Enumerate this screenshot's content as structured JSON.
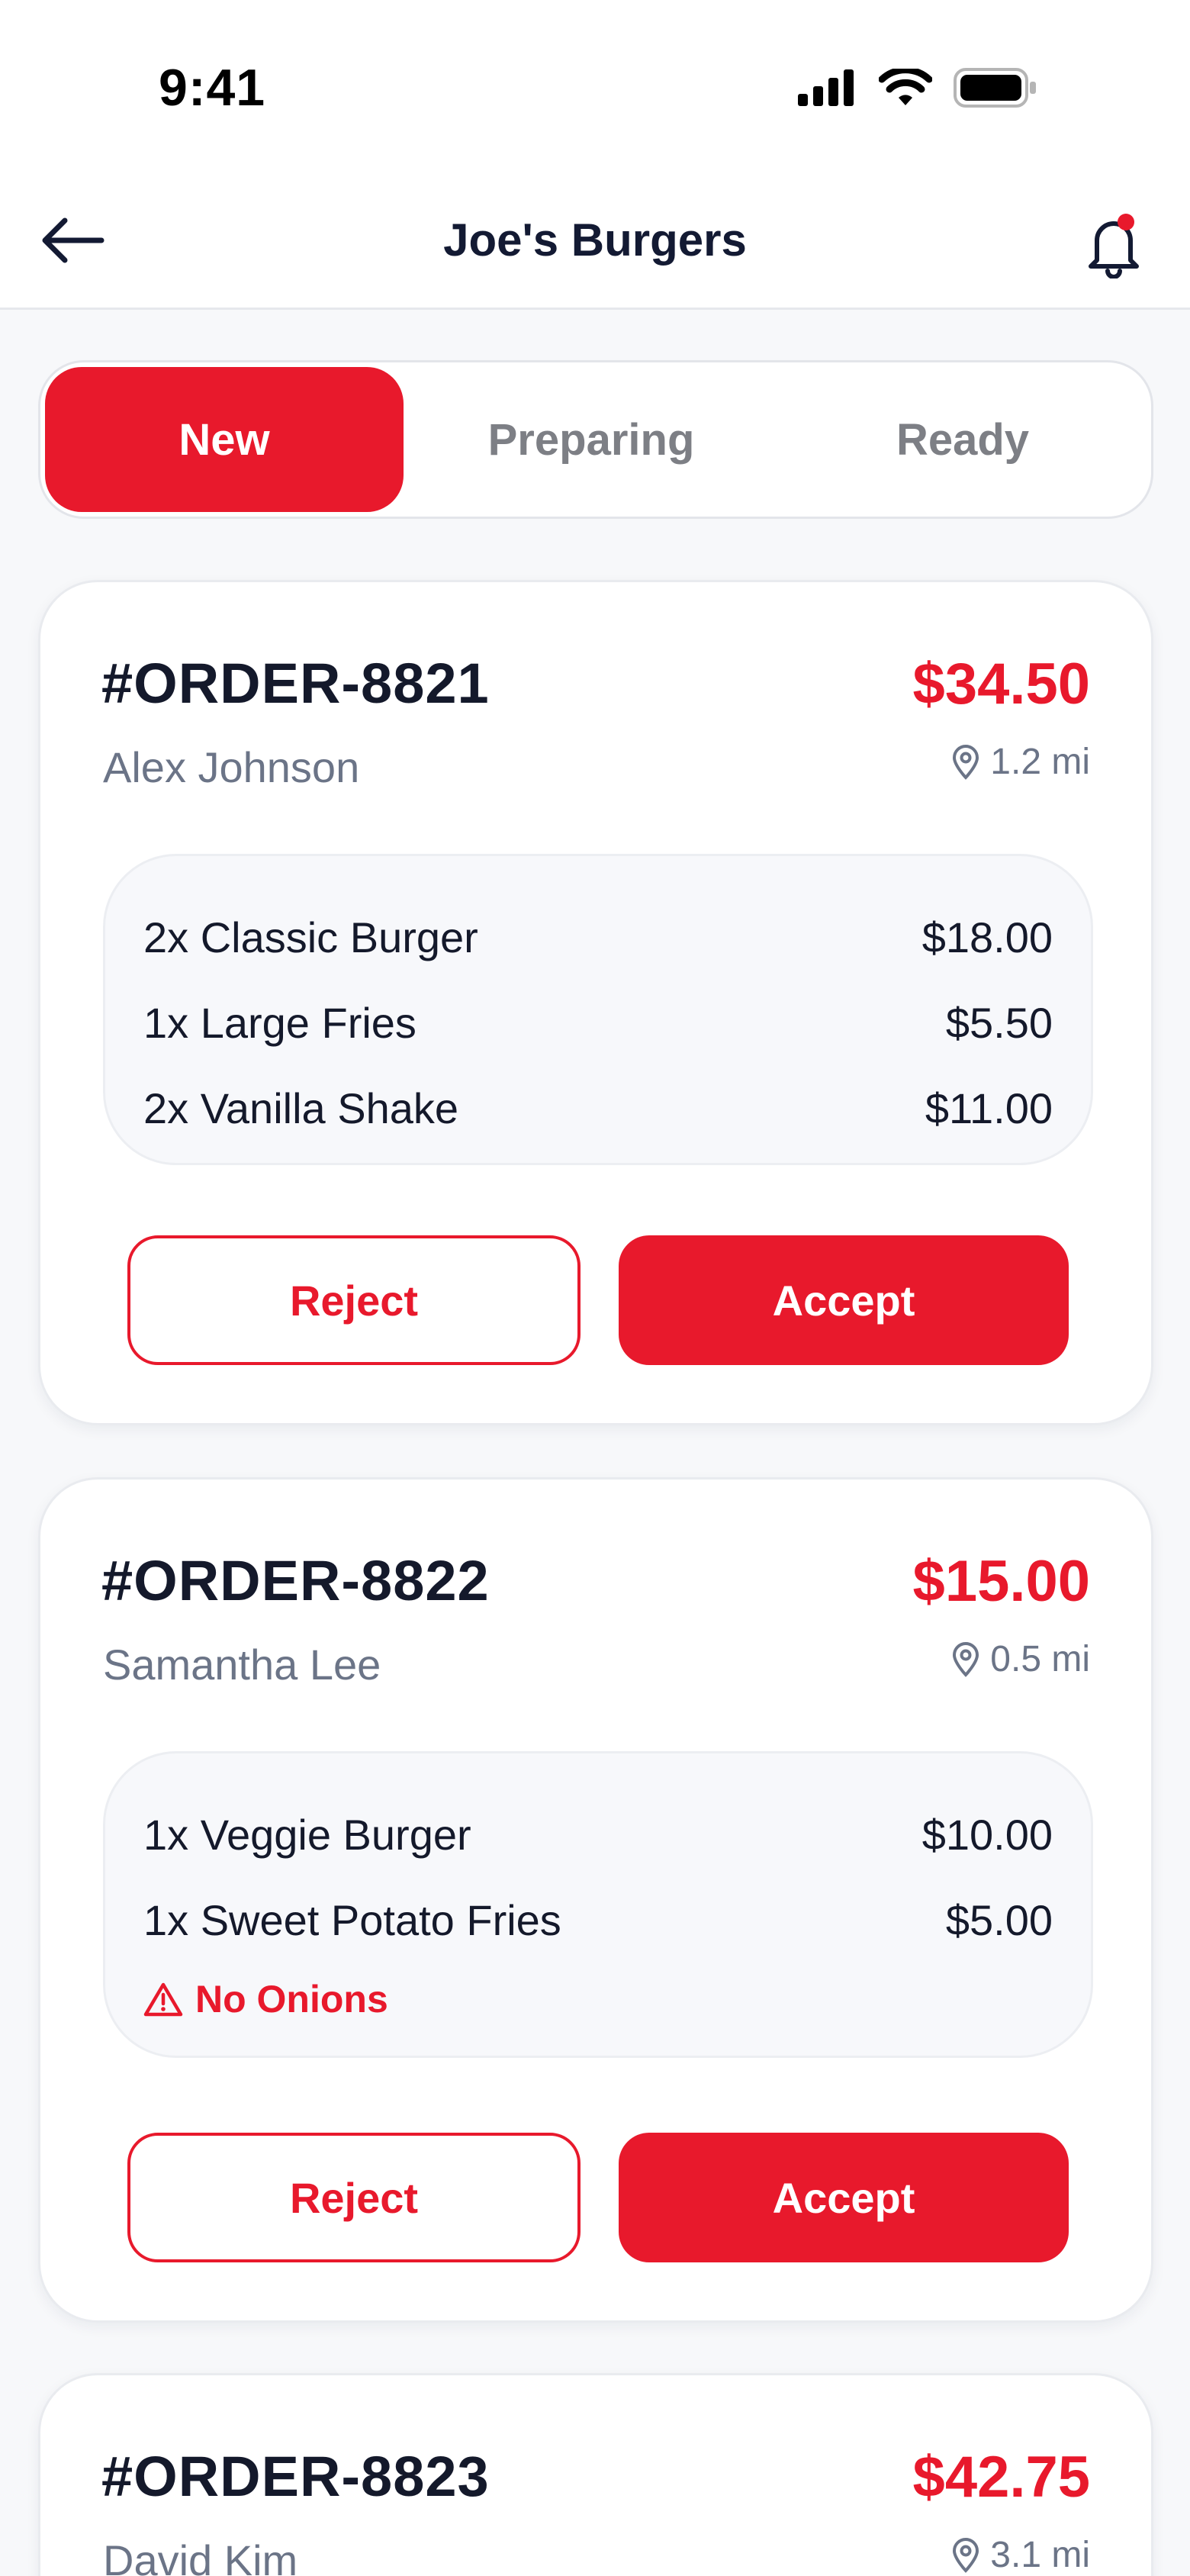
{
  "status_bar": {
    "time": "9:41"
  },
  "header": {
    "title": "Joe's Burgers"
  },
  "tabs": [
    {
      "label": "New",
      "active": true
    },
    {
      "label": "Preparing",
      "active": false
    },
    {
      "label": "Ready",
      "active": false
    }
  ],
  "orders": [
    {
      "id": "#ORDER-8821",
      "total": "$34.50",
      "customer": "Alex Johnson",
      "distance": "1.2 mi",
      "items": [
        {
          "name": "2x Classic Burger",
          "price": "$18.00"
        },
        {
          "name": "1x Large Fries",
          "price": "$5.50"
        },
        {
          "name": "2x Vanilla Shake",
          "price": "$11.00"
        }
      ],
      "reject_label": "Reject",
      "accept_label": "Accept"
    },
    {
      "id": "#ORDER-8822",
      "total": "$15.00",
      "customer": "Samantha Lee",
      "distance": "0.5 mi",
      "items": [
        {
          "name": "1x Veggie Burger",
          "price": "$10.00"
        },
        {
          "name": "1x Sweet Potato Fries",
          "price": "$5.00"
        }
      ],
      "note": "No Onions",
      "reject_label": "Reject",
      "accept_label": "Accept"
    },
    {
      "id": "#ORDER-8823",
      "total": "$42.75",
      "customer": "David Kim",
      "distance": "3.1 mi"
    }
  ],
  "colors": {
    "accent": "#e8192c",
    "text_dark": "#14192b",
    "text_muted": "#6b7487",
    "background": "#f7f8fa"
  }
}
